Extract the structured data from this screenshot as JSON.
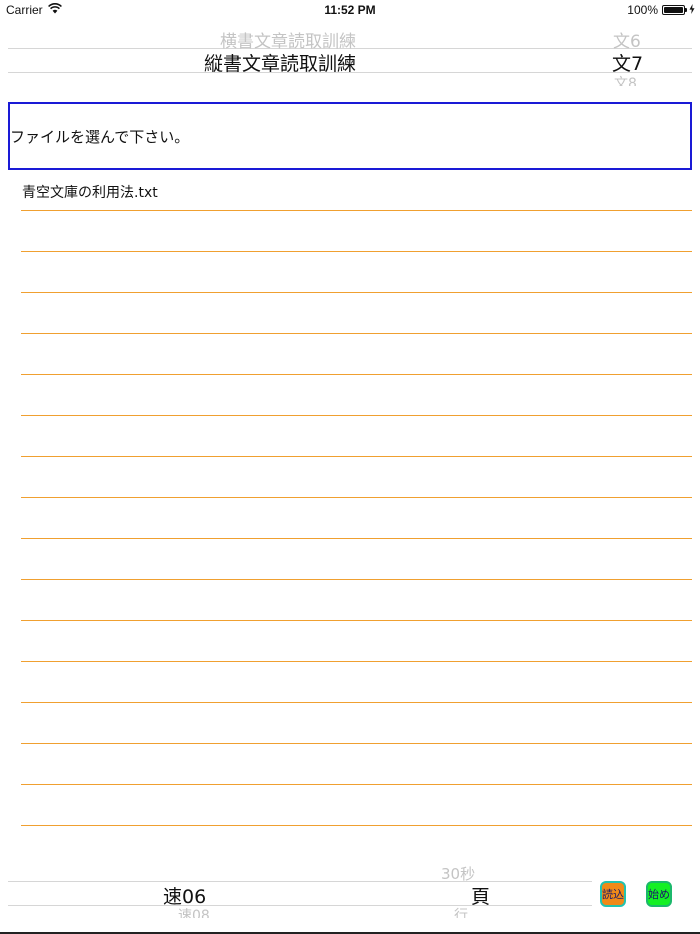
{
  "status_bar": {
    "carrier": "Carrier",
    "time": "11:52 PM",
    "battery": "100%",
    "battery_level": 1.0
  },
  "picker_top": {
    "mode_prev": "横書文章読取訓練",
    "mode_selected": "縦書文章読取訓練",
    "text_prev": "文6",
    "text_selected": "文7",
    "text_next": "文8"
  },
  "prompt": {
    "text": "ファイルを選んで下さい。"
  },
  "file_list": {
    "items": [
      "青空文庫の利用法.txt",
      "",
      "",
      "",
      "",
      "",
      "",
      "",
      "",
      "",
      "",
      "",
      "",
      "",
      "",
      ""
    ]
  },
  "picker_bottom": {
    "speed_selected": "速06",
    "speed_next": "速08",
    "unit_prev": "30秒",
    "unit_selected": "頁",
    "unit_next": "行"
  },
  "buttons": {
    "load": "読込",
    "start": "始め"
  },
  "colors": {
    "prompt_border": "#1a1ad6",
    "list_rule": "#f0a030",
    "load_button": "#f08a18",
    "start_button": "#14f024"
  }
}
